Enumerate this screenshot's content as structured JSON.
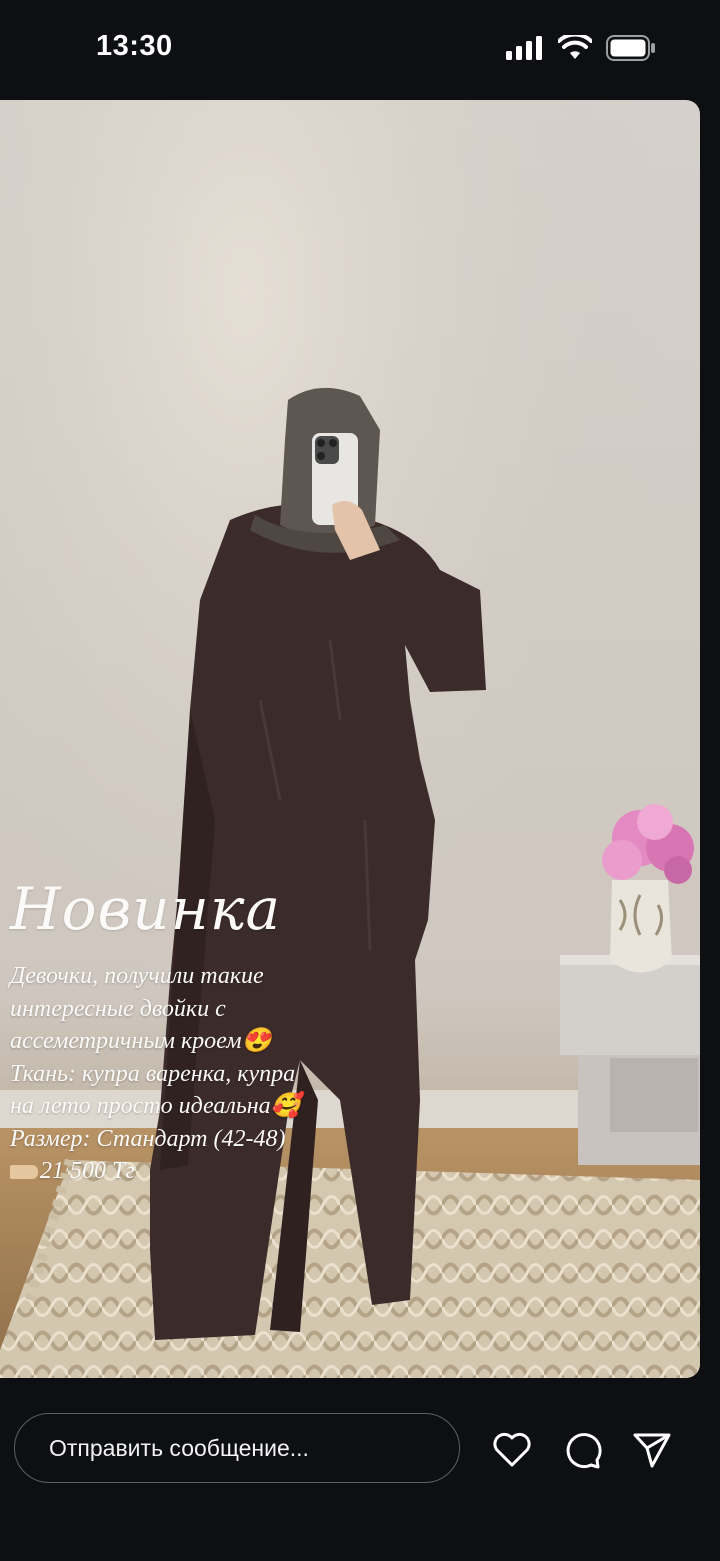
{
  "status_bar": {
    "time": "13:30",
    "icons": [
      "signal-icon",
      "wifi-icon",
      "battery-icon"
    ]
  },
  "story": {
    "caption": {
      "title": "Новинка",
      "lines": [
        "Девочки, получили такие",
        "интересные двойки с",
        "ассеметричным кроем😍",
        "Ткань: купра варенка, купра",
        "на лето просто идеальна🥰",
        "Размер: Стандарт (42-48)",
        "21 500 Тг"
      ]
    }
  },
  "footer": {
    "message_placeholder": "Отправить сообщение...",
    "actions": [
      "heart-icon",
      "comment-icon",
      "send-icon"
    ]
  },
  "colors": {
    "background": "#0d0f12",
    "outfit": "#3b2b2a",
    "caption_text": "#fbfaf8"
  }
}
